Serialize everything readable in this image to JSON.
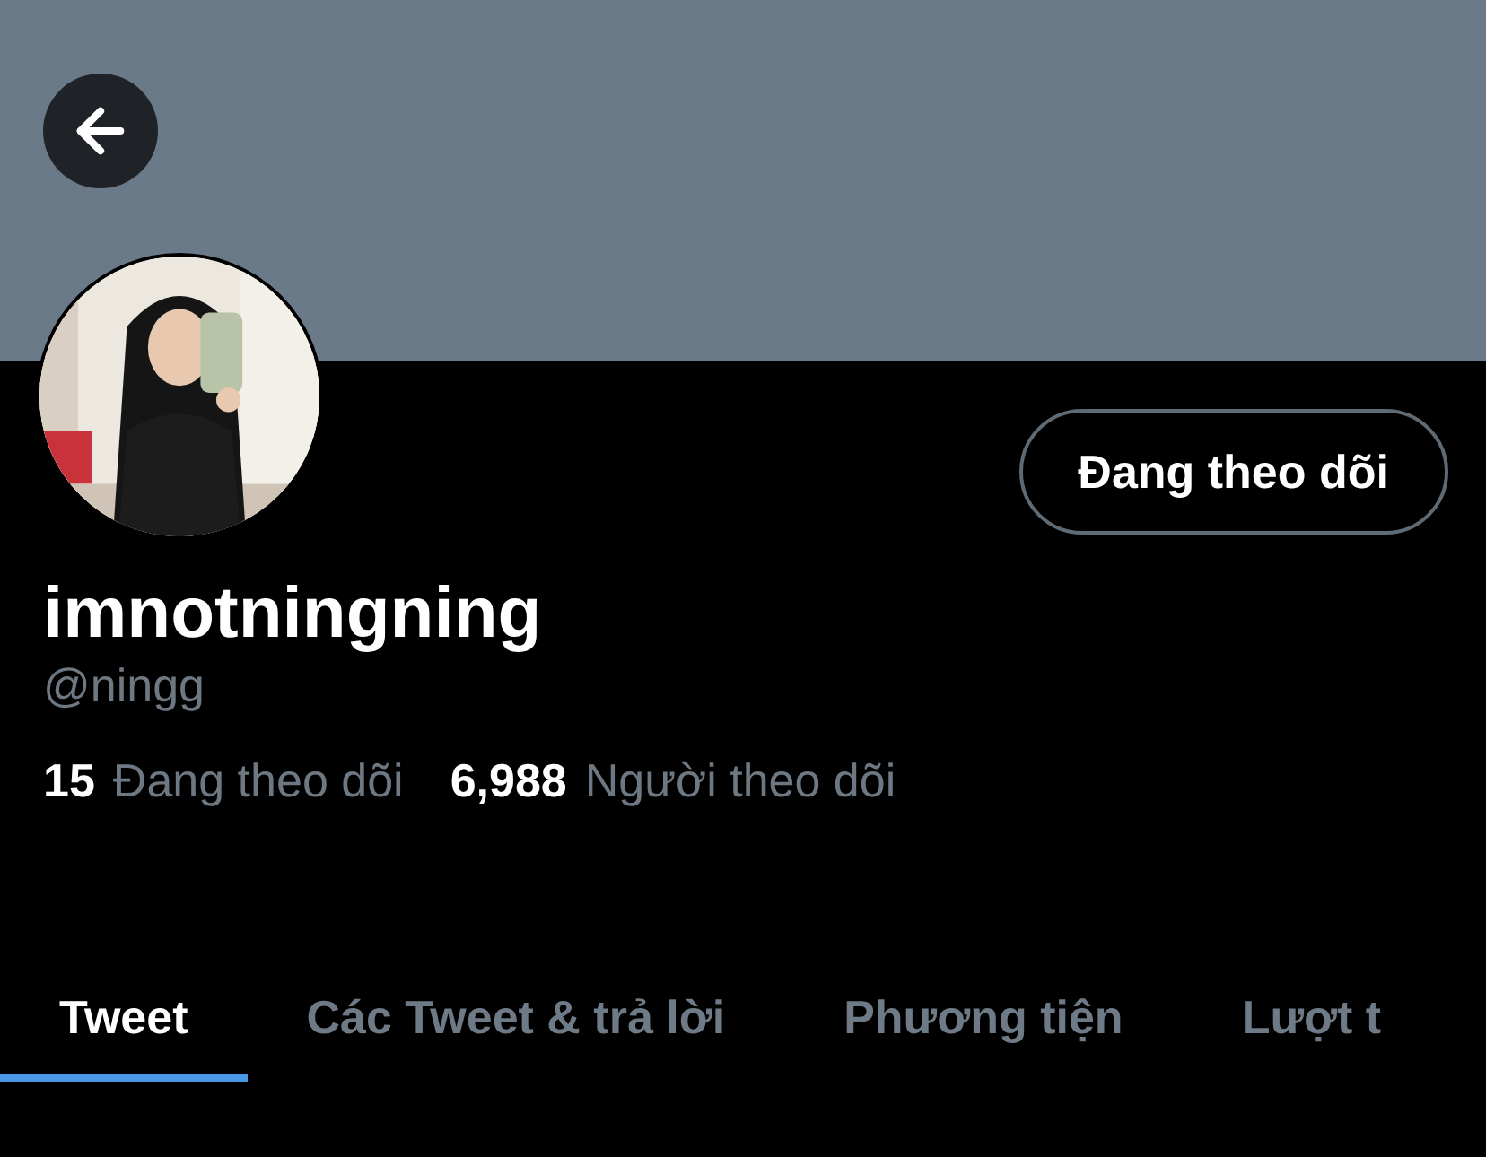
{
  "profile": {
    "display_name": "imnotningning",
    "handle": "@ningg",
    "follow_button": "Đang theo dõi"
  },
  "stats": [
    {
      "count": "15",
      "label": "Đang theo dõi"
    },
    {
      "count": "6,988",
      "label": "Người theo dõi"
    }
  ],
  "tabs": [
    {
      "label": "Tweet",
      "selected": true
    },
    {
      "label": "Các Tweet & trả lời",
      "selected": false
    },
    {
      "label": "Phương tiện",
      "selected": false
    },
    {
      "label": "Lượt t",
      "selected": false
    }
  ]
}
